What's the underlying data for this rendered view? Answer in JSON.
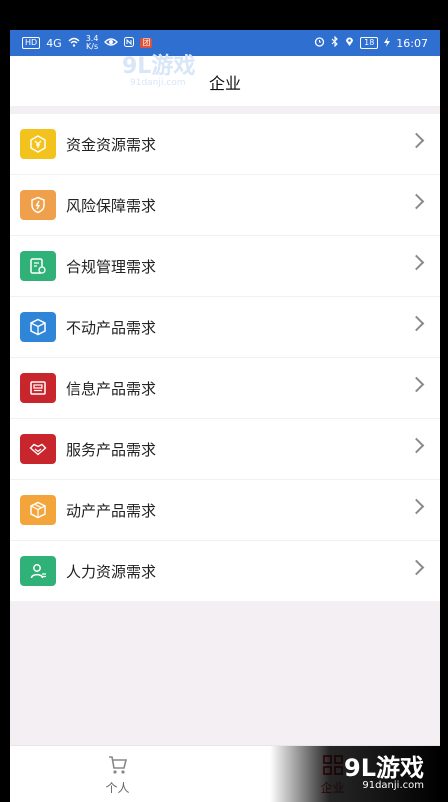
{
  "status_bar": {
    "left_chip": "HD",
    "signal": "4G",
    "speed_value": "3.4",
    "speed_unit": "K/s",
    "red_badge": "团",
    "battery": "18",
    "time": "16:07"
  },
  "watermark_top": {
    "brand": "9L游戏",
    "site": "91danji.com"
  },
  "header": {
    "title": "企业"
  },
  "colors": {
    "status_bar": "#2f6fd0",
    "accent_red": "#c8262c"
  },
  "menu": [
    {
      "label": "资金资源需求",
      "icon": "yuan-hexagon-icon",
      "color": "#f4c21d"
    },
    {
      "label": "风险保障需求",
      "icon": "shield-icon",
      "color": "#f0a04a"
    },
    {
      "label": "合规管理需求",
      "icon": "document-check-icon",
      "color": "#2fb177"
    },
    {
      "label": "不动产品需求",
      "icon": "cube-icon",
      "color": "#2f86d8"
    },
    {
      "label": "信息产品需求",
      "icon": "news-icon",
      "color": "#c8262c"
    },
    {
      "label": "服务产品需求",
      "icon": "handshake-icon",
      "color": "#c8262c"
    },
    {
      "label": "动产产品需求",
      "icon": "box-icon",
      "color": "#f3a53c"
    },
    {
      "label": "人力资源需求",
      "icon": "person-icon",
      "color": "#2fb177"
    }
  ],
  "tabs": [
    {
      "label": "个人",
      "icon": "cart-icon",
      "active": false
    },
    {
      "label": "企业",
      "icon": "grid-icon",
      "active": true
    }
  ],
  "watermark_bottom": {
    "brand": "9L游戏",
    "site": "91danji.com"
  }
}
